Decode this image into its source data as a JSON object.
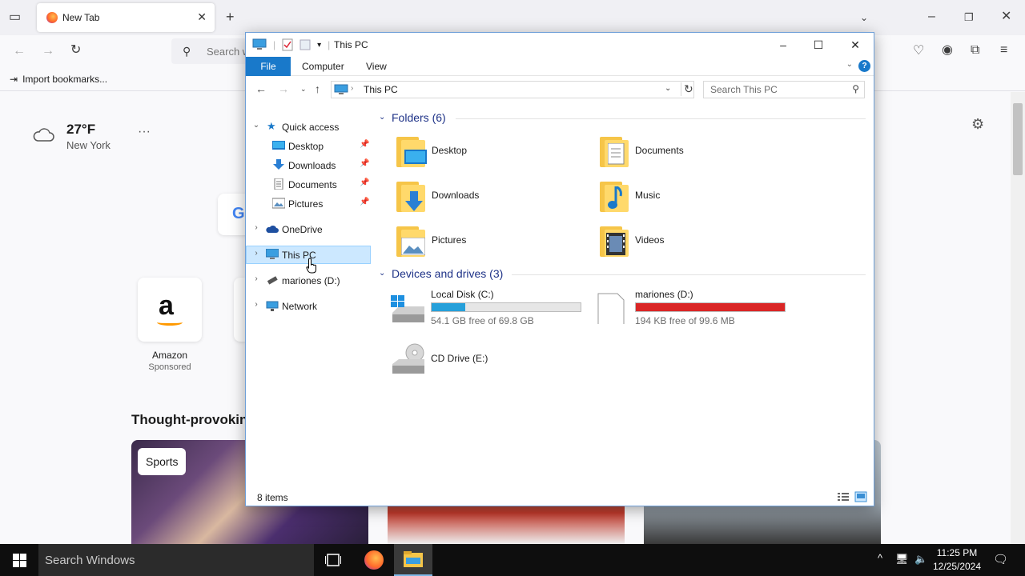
{
  "browser": {
    "tab_title": "New Tab",
    "search_placeholder": "Search w",
    "import_bookmarks": "Import bookmarks...",
    "weather": {
      "temp": "27°F",
      "city": "New York"
    },
    "shortcuts": [
      {
        "label": "Amazon",
        "sub": "Sponsored"
      }
    ],
    "stories_title": "Thought-provoking",
    "story_badge": "Sports"
  },
  "explorer": {
    "title": "This PC",
    "ribbon": {
      "file": "File",
      "tabs": [
        "Computer",
        "View"
      ]
    },
    "address": {
      "crumb": "This PC"
    },
    "search_placeholder": "Search This PC",
    "nav": {
      "quick_access": "Quick access",
      "quick_items": [
        {
          "label": "Desktop"
        },
        {
          "label": "Downloads"
        },
        {
          "label": "Documents"
        },
        {
          "label": "Pictures"
        }
      ],
      "onedrive": "OneDrive",
      "this_pc": "This PC",
      "usb": "mariones (D:)",
      "network": "Network"
    },
    "folders_header": "Folders (6)",
    "folders": [
      {
        "label": "Desktop"
      },
      {
        "label": "Documents"
      },
      {
        "label": "Downloads"
      },
      {
        "label": "Music"
      },
      {
        "label": "Pictures"
      },
      {
        "label": "Videos"
      }
    ],
    "devices_header": "Devices and drives (3)",
    "drives": [
      {
        "name": "Local Disk (C:)",
        "free": "54.1 GB free of 69.8 GB",
        "used_fraction": 0.225,
        "bar_color": "#26a0da"
      },
      {
        "name": "mariones (D:)",
        "free": "194 KB free of 99.6 MB",
        "used_fraction": 0.998,
        "bar_color": "#da2626"
      },
      {
        "name": "CD Drive (E:)"
      }
    ],
    "status": "8 items"
  },
  "taskbar": {
    "search_placeholder": "Search Windows",
    "time": "11:25 PM",
    "date": "12/25/2024"
  }
}
